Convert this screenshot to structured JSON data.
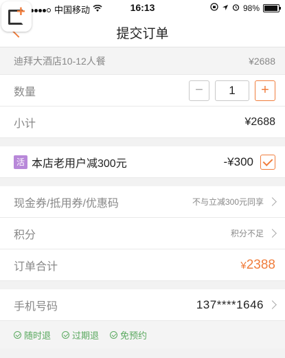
{
  "status_bar": {
    "carrier": "中国移动",
    "time": "16:13",
    "battery": "98%",
    "battery_level": 0.98
  },
  "nav": {
    "title": "提交订单"
  },
  "product": {
    "name": "迪拜大酒店10-12人餐",
    "price": "¥2688"
  },
  "quantity": {
    "label": "数量",
    "minus": "−",
    "value": "1",
    "plus": "+"
  },
  "subtotal": {
    "label": "小计",
    "value": "¥2688"
  },
  "promotion": {
    "badge": "活",
    "text": "本店老用户减300元",
    "discount": "-¥300",
    "checked": true
  },
  "coupon": {
    "label": "现金券/抵用券/优惠码",
    "hint": "不与立减300元同享"
  },
  "points": {
    "label": "积分",
    "hint": "积分不足"
  },
  "order_total": {
    "label": "订单合计",
    "currency": "¥",
    "amount": "2388"
  },
  "phone": {
    "label": "手机号码",
    "value": "137****1646"
  },
  "guarantees": [
    "随时退",
    "过期退",
    "免预约"
  ],
  "colors": {
    "accent": "#f07d3c",
    "promo_badge": "#b888d9",
    "guarantee": "#5aa95f"
  }
}
